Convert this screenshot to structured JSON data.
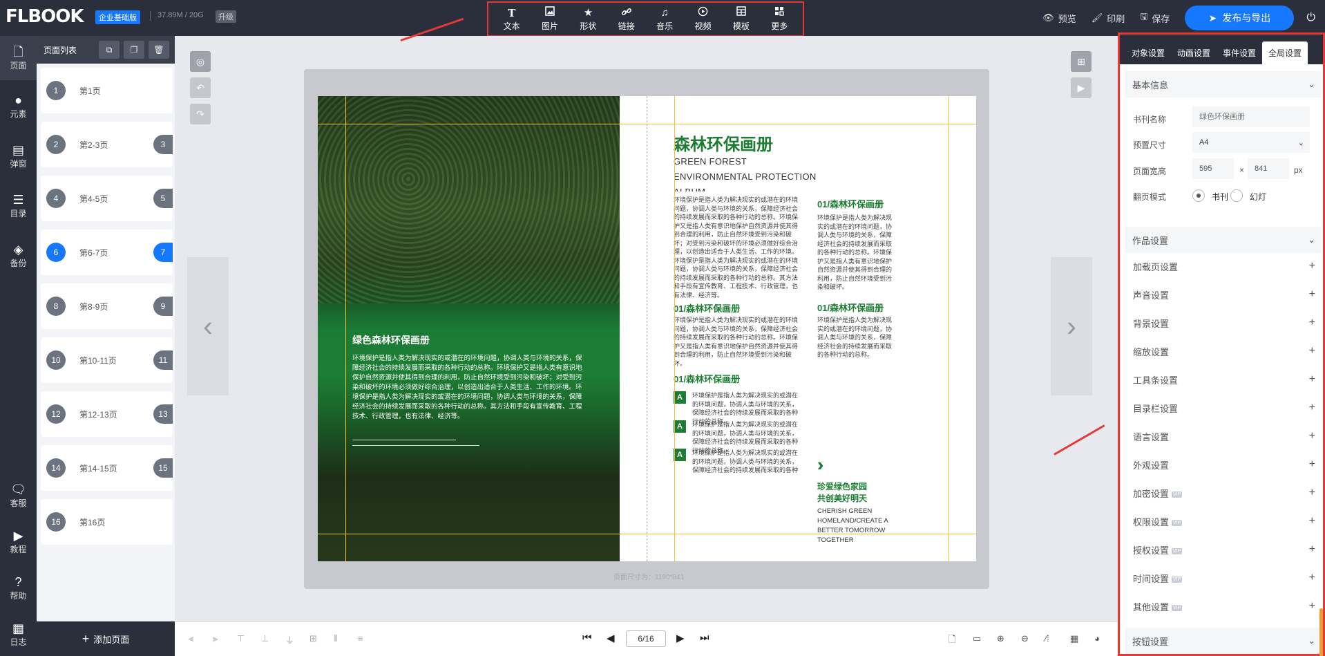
{
  "header": {
    "logo": "FLBOOK",
    "edition": "企业基础版",
    "storage": "37.89M / 20G",
    "upgrade": "升级",
    "tools": [
      {
        "icon": "text-icon",
        "label": "文本"
      },
      {
        "icon": "image-icon",
        "label": "图片"
      },
      {
        "icon": "star-icon",
        "label": "形状"
      },
      {
        "icon": "link-icon",
        "label": "链接"
      },
      {
        "icon": "music-icon",
        "label": "音乐"
      },
      {
        "icon": "play-icon",
        "label": "视频"
      },
      {
        "icon": "template-icon",
        "label": "模板"
      },
      {
        "icon": "more-icon",
        "label": "更多"
      }
    ],
    "preview": "预览",
    "print": "印刷",
    "save": "保存",
    "publish": "发布与导出"
  },
  "leftnav": {
    "items": [
      {
        "icon": "page-icon",
        "label": "页面"
      },
      {
        "icon": "element-icon",
        "label": "元素"
      },
      {
        "icon": "popup-icon",
        "label": "弹窗"
      },
      {
        "icon": "toc-icon",
        "label": "目录"
      },
      {
        "icon": "backup-icon",
        "label": "备份"
      },
      {
        "icon": "service-icon",
        "label": "客服"
      },
      {
        "icon": "tutorial-icon",
        "label": "教程"
      },
      {
        "icon": "help-icon",
        "label": "帮助"
      },
      {
        "icon": "log-icon",
        "label": "日志"
      }
    ]
  },
  "pagelist": {
    "title": "页面列表",
    "items": [
      {
        "num": "1",
        "label": "第1页",
        "num2": ""
      },
      {
        "num": "2",
        "label": "第2-3页",
        "num2": "3"
      },
      {
        "num": "4",
        "label": "第4-5页",
        "num2": "5"
      },
      {
        "num": "6",
        "label": "第6-7页",
        "num2": "7"
      },
      {
        "num": "8",
        "label": "第8-9页",
        "num2": "9"
      },
      {
        "num": "10",
        "label": "第10-11页",
        "num2": "11"
      },
      {
        "num": "12",
        "label": "第12-13页",
        "num2": "13"
      },
      {
        "num": "14",
        "label": "第14-15页",
        "num2": "15"
      },
      {
        "num": "16",
        "label": "第16页",
        "num2": ""
      }
    ],
    "add": "添加页面"
  },
  "spread": {
    "left_title": "绿色森林环保画册",
    "left_body": "环境保护是指人类为解决现实的或潜在的环境问题，协调人类与环境的关系，保障经济社会的持续发展而采取的各种行动的总称。环境保护又是指人类有意识地保护自然资源并使其得到合理的利用，防止自然环境受到污染和破坏；对受到污染和破坏的环境必须做好综合治理，以创造出适合于人类生活、工作的环境。环境保护是指人类为解决现实的或潜在的环境问题，协调人类与环境的关系，保障经济社会的持续发展而采取的各种行动的总称。其方法和手段有宣传教育、工程技术、行政管理，也有法律、经济等。",
    "right_title": "森林环保画册",
    "right_sub": "GREEN FOREST ENVIRONMENTAL PROTECTION ALBUM",
    "intro": "环境保护是指人类为解决现实的或潜在的环境问题，协调人类与环境的关系，保障经济社会的持续发展而采取的各种行动的总称。环境保护又是指人类有意识地保护自然资源并使其得到合理的利用，防止自然环境受到污染和破坏；对受到污染和破坏的环境必须做好综合治理，以创造出适合于人类生活、工作的环境。环境保护是指人类为解决现实的或潜在的环境问题，协调人类与环境的关系，保障经济社会的持续发展而采取的各种行动的总称。其方法和手段有宣传教育、工程技术、行政管理，也有法律、经济等。",
    "heading": "01/森林环保画册",
    "short_para": "环境保护是指人类为解决现实的或潜在的环境问题，协调人类与环境的关系，保障经济社会的持续发展而采取的各种行动的总称。环境保护又是指人类有意识地保护自然资源并使其得到合理的利用，防止自然环境受到污染和破坏。",
    "short_para2": "环境保护是指人类为解决现实的或潜在的环境问题，协调人类与环境的关系，保障经济社会的持续发展而采取的各种行动的总称。",
    "list_letter": "A",
    "list_item": "环境保护是指人类为解决现实的或潜在的环境问题，协调人类与环境的关系，保障经济社会的持续发展而采取的各种行动的总称。",
    "slogan_1": "珍爱绿色家园",
    "slogan_2": "共创美好明天",
    "slogan_en": "CHERISH GREEN HOMELAND/CREATE A BETTER TOMORROW TOGETHER",
    "page_size": "页面尺寸为：1190*841"
  },
  "rightpanel": {
    "tabs": [
      "对象设置",
      "动画设置",
      "事件设置",
      "全局设置"
    ],
    "basic_info": "基本信息",
    "book_name_label": "书刊名称",
    "book_name_placeholder": "绿色环保画册",
    "preset_label": "预置尺寸",
    "preset_value": "A4",
    "size_label": "页面宽高",
    "width": "595",
    "times": "×",
    "height": "841",
    "unit": "px",
    "flip_label": "翻页模式",
    "flip_book": "书刊",
    "flip_slide": "幻灯",
    "works_settings": "作品设置",
    "rows": [
      {
        "label": "加载页设置",
        "vip": ""
      },
      {
        "label": "声音设置",
        "vip": ""
      },
      {
        "label": "背景设置",
        "vip": ""
      },
      {
        "label": "缩放设置",
        "vip": ""
      },
      {
        "label": "工具条设置",
        "vip": ""
      },
      {
        "label": "目录栏设置",
        "vip": ""
      },
      {
        "label": "语言设置",
        "vip": ""
      },
      {
        "label": "外观设置",
        "vip": ""
      },
      {
        "label": "加密设置",
        "vip": "VIP"
      },
      {
        "label": "权限设置",
        "vip": "VIP"
      },
      {
        "label": "授权设置",
        "vip": "VIP"
      },
      {
        "label": "时间设置",
        "vip": "VIP"
      },
      {
        "label": "其他设置",
        "vip": "VIP"
      }
    ],
    "button_settings": "按钮设置"
  },
  "bottombar": {
    "page_indicator": "6/16"
  }
}
